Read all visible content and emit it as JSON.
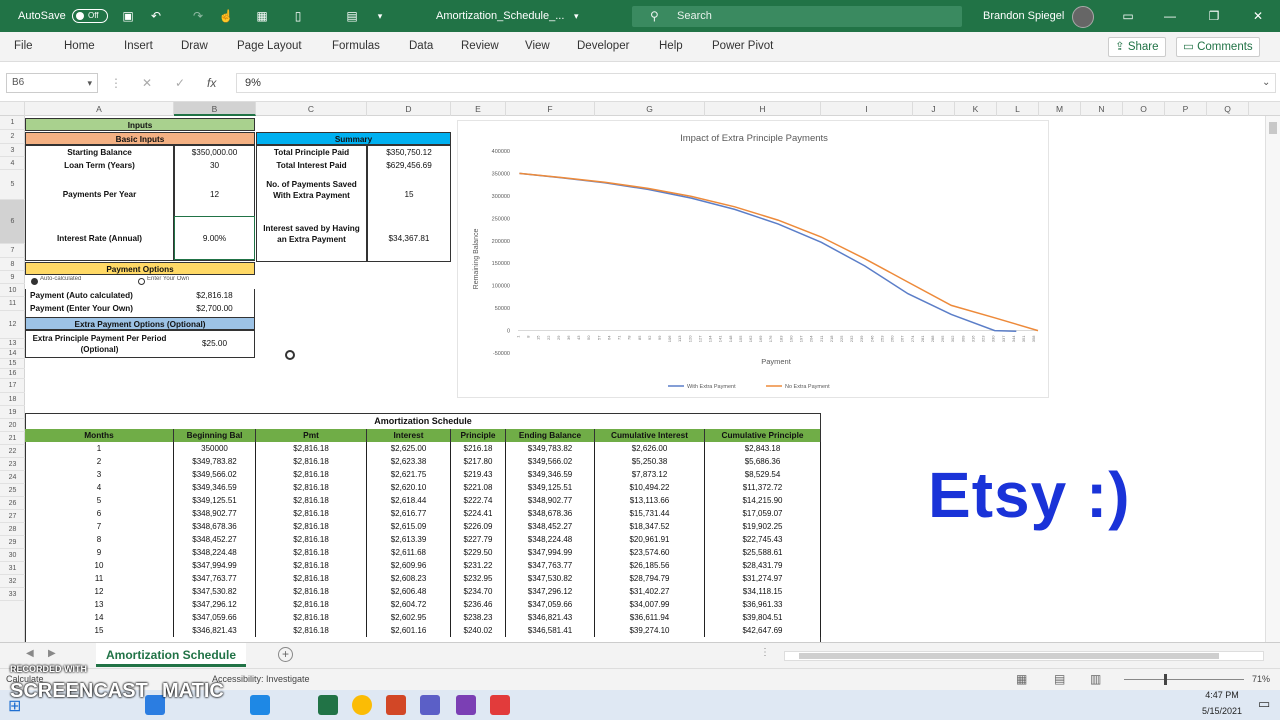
{
  "titlebar": {
    "autosave": "AutoSave",
    "toggle": "Off",
    "filename": "Amortization_Schedule_...",
    "search_placeholder": "Search",
    "user": "Brandon Spiegel"
  },
  "ribbon": {
    "tabs": [
      "File",
      "Home",
      "Insert",
      "Draw",
      "Page Layout",
      "Formulas",
      "Data",
      "Review",
      "View",
      "Developer",
      "Help",
      "Power Pivot"
    ],
    "share": "Share",
    "comments": "Comments"
  },
  "formula_bar": {
    "name_box": "B6",
    "fx": "fx",
    "value": "9%"
  },
  "columns": [
    "A",
    "B",
    "C",
    "D",
    "E",
    "F",
    "G",
    "H",
    "I",
    "J",
    "K",
    "L",
    "M",
    "N",
    "O",
    "P",
    "Q"
  ],
  "rows": [
    "1",
    "2",
    "3",
    "4",
    "5",
    "6",
    "7",
    "8",
    "9",
    "10",
    "11",
    "12",
    "13",
    "14",
    "15",
    "16",
    "17",
    "18",
    "19",
    "20",
    "21",
    "22",
    "23",
    "24",
    "25",
    "26",
    "27",
    "28",
    "29",
    "30",
    "31",
    "32",
    "33"
  ],
  "inputs": {
    "title": "Inputs",
    "basic_inputs": "Basic Inputs",
    "starting_balance_label": "Starting Balance",
    "starting_balance": "$350,000.00",
    "loan_term_label": "Loan Term (Years)",
    "loan_term": "30",
    "payments_per_year_label": "Payments Per Year",
    "payments_per_year": "12",
    "interest_rate_label": "Interest Rate (Annual)",
    "interest_rate": "9.00%",
    "payment_options": "Payment Options",
    "auto_calc": "Auto-calculated",
    "enter_own": "Enter Your Own",
    "payment_auto_label": "Payment (Auto calculated)",
    "payment_auto": "$2,816.18",
    "payment_own_label": "Payment (Enter Your Own)",
    "payment_own": "$2,700.00",
    "extra_options": "Extra Payment Options (Optional)",
    "extra_label": "Extra Principle Payment Per Period (Optional)",
    "extra": "$25.00"
  },
  "summary": {
    "title": "Summary",
    "total_principle_label": "Total Principle Paid",
    "total_principle": "$350,750.12",
    "total_interest_label": "Total Interest Paid",
    "total_interest": "$629,456.69",
    "payments_saved_label": "No. of Payments Saved With Extra Payment",
    "payments_saved": "15",
    "interest_saved_label": "Interest saved by Having an Extra Payment",
    "interest_saved": "$34,367.81"
  },
  "schedule": {
    "title": "Amortization Schedule",
    "headers": [
      "Months",
      "Beginning Bal",
      "Pmt",
      "Interest",
      "Principle",
      "Ending Balance",
      "Cumulative Interest",
      "Cumulative Principle"
    ],
    "rows": [
      [
        "1",
        "350000",
        "$2,816.18",
        "$2,625.00",
        "$216.18",
        "$349,783.82",
        "$2,626.00",
        "$2,843.18"
      ],
      [
        "2",
        "$349,783.82",
        "$2,816.18",
        "$2,623.38",
        "$217.80",
        "$349,566.02",
        "$5,250.38",
        "$5,686.36"
      ],
      [
        "3",
        "$349,566.02",
        "$2,816.18",
        "$2,621.75",
        "$219.43",
        "$349,346.59",
        "$7,873.12",
        "$8,529.54"
      ],
      [
        "4",
        "$349,346.59",
        "$2,816.18",
        "$2,620.10",
        "$221.08",
        "$349,125.51",
        "$10,494.22",
        "$11,372.72"
      ],
      [
        "5",
        "$349,125.51",
        "$2,816.18",
        "$2,618.44",
        "$222.74",
        "$348,902.77",
        "$13,113.66",
        "$14,215.90"
      ],
      [
        "6",
        "$348,902.77",
        "$2,816.18",
        "$2,616.77",
        "$224.41",
        "$348,678.36",
        "$15,731.44",
        "$17,059.07"
      ],
      [
        "7",
        "$348,678.36",
        "$2,816.18",
        "$2,615.09",
        "$226.09",
        "$348,452.27",
        "$18,347.52",
        "$19,902.25"
      ],
      [
        "8",
        "$348,452.27",
        "$2,816.18",
        "$2,613.39",
        "$227.79",
        "$348,224.48",
        "$20,961.91",
        "$22,745.43"
      ],
      [
        "9",
        "$348,224.48",
        "$2,816.18",
        "$2,611.68",
        "$229.50",
        "$347,994.99",
        "$23,574.60",
        "$25,588.61"
      ],
      [
        "10",
        "$347,994.99",
        "$2,816.18",
        "$2,609.96",
        "$231.22",
        "$347,763.77",
        "$26,185.56",
        "$28,431.79"
      ],
      [
        "11",
        "$347,763.77",
        "$2,816.18",
        "$2,608.23",
        "$232.95",
        "$347,530.82",
        "$28,794.79",
        "$31,274.97"
      ],
      [
        "12",
        "$347,530.82",
        "$2,816.18",
        "$2,606.48",
        "$234.70",
        "$347,296.12",
        "$31,402.27",
        "$34,118.15"
      ],
      [
        "13",
        "$347,296.12",
        "$2,816.18",
        "$2,604.72",
        "$236.46",
        "$347,059.66",
        "$34,007.99",
        "$36,961.33"
      ],
      [
        "14",
        "$347,059.66",
        "$2,816.18",
        "$2,602.95",
        "$238.23",
        "$346,821.43",
        "$36,611.94",
        "$39,804.51"
      ],
      [
        "15",
        "$346,821.43",
        "$2,816.18",
        "$2,601.16",
        "$240.02",
        "$346,581.41",
        "$39,274.10",
        "$42,647.69"
      ]
    ]
  },
  "chart_data": {
    "type": "line",
    "title": "Impact of Extra Principle Payments",
    "xlabel": "Payment",
    "ylabel": "Remaining Balance",
    "ylim": [
      -50000,
      400000
    ],
    "yticks": [
      "400000",
      "350000",
      "300000",
      "250000",
      "200000",
      "150000",
      "100000",
      "50000",
      "0",
      "-50000"
    ],
    "grid": false,
    "legend": "bottom",
    "xmax": 360,
    "series": [
      {
        "name": "With Extra Payment",
        "color": "#5b7ec8",
        "x": [
          1,
          30,
          60,
          90,
          120,
          150,
          180,
          210,
          240,
          270,
          300,
          330,
          345
        ],
        "values": [
          350000,
          340400,
          329200,
          314400,
          295000,
          270000,
          237500,
          196500,
          144000,
          82000,
          36000,
          0,
          -1500
        ]
      },
      {
        "name": "No Extra Payment",
        "color": "#ed8a3a",
        "x": [
          1,
          30,
          60,
          90,
          120,
          150,
          180,
          210,
          240,
          270,
          300,
          330,
          360
        ],
        "values": [
          350000,
          341000,
          330600,
          316600,
          298800,
          275600,
          246000,
          208500,
          160000,
          108000,
          56000,
          28500,
          0
        ]
      }
    ]
  },
  "sheet": {
    "tab": "Amortization Schedule",
    "add": "+"
  },
  "statusbar": {
    "mode": "Calculate",
    "accessibility": "Accessibility: Investigate",
    "zoom": "71%"
  },
  "watermarks": {
    "etsy": "Etsy :)",
    "recorded": "RECORDED WITH",
    "screencast": "SCREENCAST",
    "matic": "MATIC"
  },
  "taskbar": {
    "time": "4:47 PM",
    "date": "5/15/2021"
  }
}
